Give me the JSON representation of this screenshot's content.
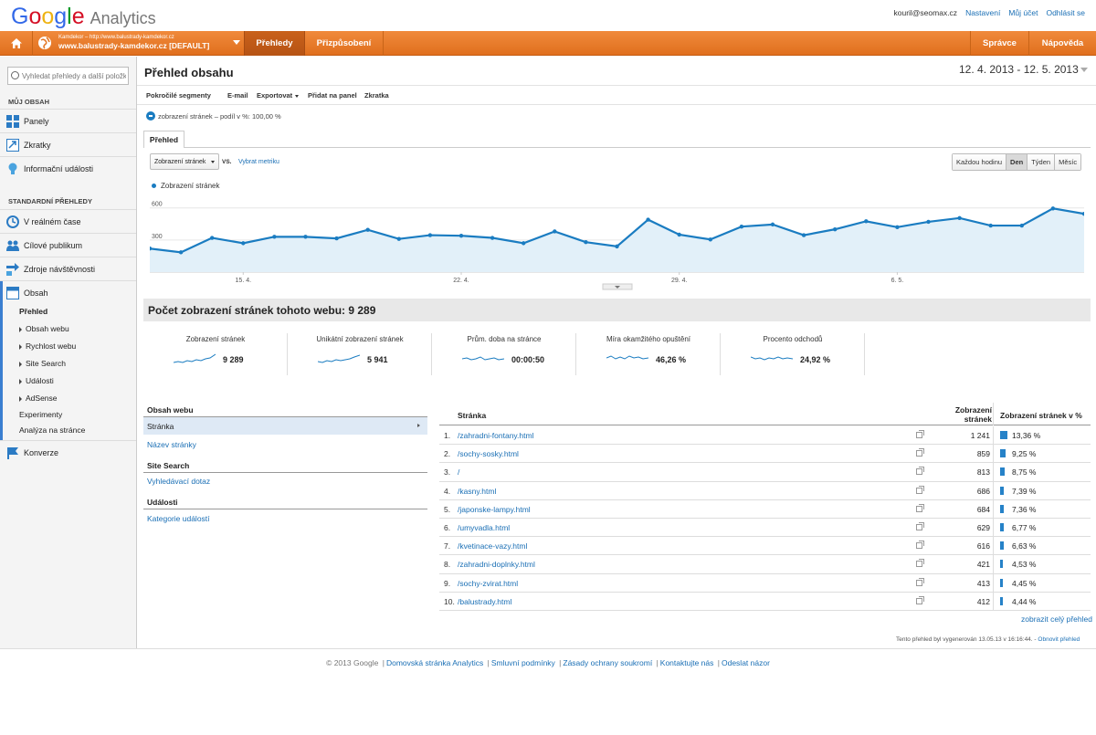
{
  "header": {
    "logo_google": "Google",
    "logo_product": "Analytics",
    "user_email": "kouril@seomax.cz",
    "links": [
      "Nastavení",
      "Můj účet",
      "Odhlásit se"
    ]
  },
  "topbar": {
    "account_small": "Kamdekor – http://www.balustrady-kamdekor.cz",
    "account_big": "www.balustrady-kamdekor.cz [DEFAULT]",
    "tabs": [
      "Přehledy",
      "Přizpůsobení"
    ],
    "right_tabs": [
      "Správce",
      "Nápověda"
    ]
  },
  "sidebar": {
    "search_placeholder": "Vyhledat přehledy a další položky",
    "my_content_heading": "MŮJ OBSAH",
    "my_items": [
      "Panely",
      "Zkratky",
      "Informační události"
    ],
    "standard_heading": "STANDARDNÍ PŘEHLEDY",
    "std_items": [
      "V reálném čase",
      "Cílové publikum",
      "Zdroje návštěvnosti",
      "Obsah"
    ],
    "content_sub": [
      "Přehled",
      "Obsah webu",
      "Rychlost webu",
      "Site Search",
      "Události",
      "AdSense",
      "Experimenty",
      "Analýza na stránce"
    ],
    "last_item": "Konverze"
  },
  "main": {
    "title": "Přehled obsahu",
    "date_range": "12. 4. 2013 - 12. 5. 2013",
    "toolbar": [
      "Pokročilé segmenty",
      "E-mail",
      "Exportovat",
      "Přidat na panel",
      "Zkratka"
    ],
    "segment": "zobrazení stránek – podíl v %: 100,00 %",
    "tab": "Přehled",
    "metric_select": "Zobrazení stránek",
    "vs": "VS.",
    "pick_metric": "Vybrat metriku",
    "granularity": [
      "Každou hodinu",
      "Den",
      "Týden",
      "Měsíc"
    ],
    "legend": "Zobrazení stránek",
    "total": "Počet zobrazení stránek tohoto webu: 9 289"
  },
  "chart_data": {
    "type": "area",
    "series": [
      {
        "name": "Zobrazení stránek",
        "values": [
          220,
          185,
          320,
          270,
          330,
          330,
          315,
          395,
          310,
          345,
          340,
          320,
          270,
          380,
          280,
          240,
          490,
          350,
          305,
          425,
          445,
          345,
          400,
          475,
          420,
          470,
          505,
          435,
          435,
          595,
          545
        ]
      }
    ],
    "y_ticks": [
      "600",
      "300"
    ],
    "x_ticks": [
      "15. 4.",
      "22. 4.",
      "29. 4.",
      "6. 5."
    ],
    "x_range": [
      "12. 4.",
      "12. 5."
    ],
    "ylim": [
      0,
      700
    ],
    "color": "#1a7cc1"
  },
  "scorecards": [
    {
      "label": "Zobrazení stránek",
      "value": "9 289"
    },
    {
      "label": "Unikátní zobrazení stránek",
      "value": "5 941"
    },
    {
      "label": "Prům. doba na stránce",
      "value": "00:00:50"
    },
    {
      "label": "Míra okamžitého opuštění",
      "value": "46,26 %"
    },
    {
      "label": "Procento odchodů",
      "value": "24,92 %"
    }
  ],
  "dimensions": {
    "h1": "Obsah webu",
    "sel": "Stránka",
    "link1": "Název stránky",
    "h2": "Site Search",
    "link2": "Vyhledávací dotaz",
    "h3": "Události",
    "link3": "Kategorie událostí"
  },
  "table": {
    "col1": "Stránka",
    "col2": "Zobrazení stránek",
    "col3": "Zobrazení stránek v %",
    "rows": [
      {
        "n": "1.",
        "page": "/zahradni-fontany.html",
        "views": "1 241",
        "pct": "13,36 %",
        "frac": 0.1336
      },
      {
        "n": "2.",
        "page": "/sochy-sosky.html",
        "views": "859",
        "pct": "9,25 %",
        "frac": 0.0925
      },
      {
        "n": "3.",
        "page": "/",
        "views": "813",
        "pct": "8,75 %",
        "frac": 0.0875
      },
      {
        "n": "4.",
        "page": "/kasny.html",
        "views": "686",
        "pct": "7,39 %",
        "frac": 0.0739
      },
      {
        "n": "5.",
        "page": "/japonske-lampy.html",
        "views": "684",
        "pct": "7,36 %",
        "frac": 0.0736
      },
      {
        "n": "6.",
        "page": "/umyvadla.html",
        "views": "629",
        "pct": "6,77 %",
        "frac": 0.0677
      },
      {
        "n": "7.",
        "page": "/kvetinace-vazy.html",
        "views": "616",
        "pct": "6,63 %",
        "frac": 0.0663
      },
      {
        "n": "8.",
        "page": "/zahradni-doplnky.html",
        "views": "421",
        "pct": "4,53 %",
        "frac": 0.0453
      },
      {
        "n": "9.",
        "page": "/sochy-zvirat.html",
        "views": "413",
        "pct": "4,45 %",
        "frac": 0.0445
      },
      {
        "n": "10.",
        "page": "/balustrady.html",
        "views": "412",
        "pct": "4,44 %",
        "frac": 0.0444
      }
    ],
    "full_report": "zobrazit celý přehled",
    "generated_note": "Tento přehled byl vygenerován 13.05.13 v 16:16:44. -",
    "refresh": "Obnovit přehled"
  },
  "footer": {
    "copyright": "© 2013 Google",
    "links": [
      "Domovská stránka Analytics",
      "Smluvní podmínky",
      "Zásady ochrany soukromí",
      "Kontaktujte nás",
      "Odeslat názor"
    ]
  }
}
